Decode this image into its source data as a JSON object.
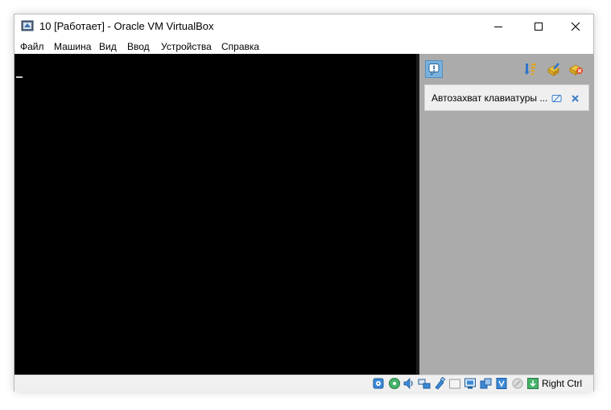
{
  "window": {
    "title": "10 [Работает] - Oracle VM VirtualBox"
  },
  "menu": {
    "items": [
      "Файл",
      "Машина",
      "Вид",
      "Ввод",
      "Устройства",
      "Справка"
    ]
  },
  "notification_panel": {
    "toolbar_icons": [
      "notification-center-icon",
      "sort-icon",
      "clear-icon",
      "close-all-icon"
    ],
    "notifications": [
      {
        "text": "Автозахват клавиатуры ..."
      }
    ]
  },
  "statusbar": {
    "icons": [
      "hard-disk-icon",
      "optical-drive-icon",
      "audio-icon",
      "network-icon",
      "usb-icon",
      "shared-folders-icon",
      "display-icon",
      "video-capture-icon",
      "features-icon",
      "mouse-integration-icon",
      "keyboard-icon"
    ],
    "host_key": "Right Ctrl"
  },
  "colors": {
    "vm_screen": "#000000",
    "panel_background": "#ababab",
    "accent": "#3b8ad8"
  }
}
